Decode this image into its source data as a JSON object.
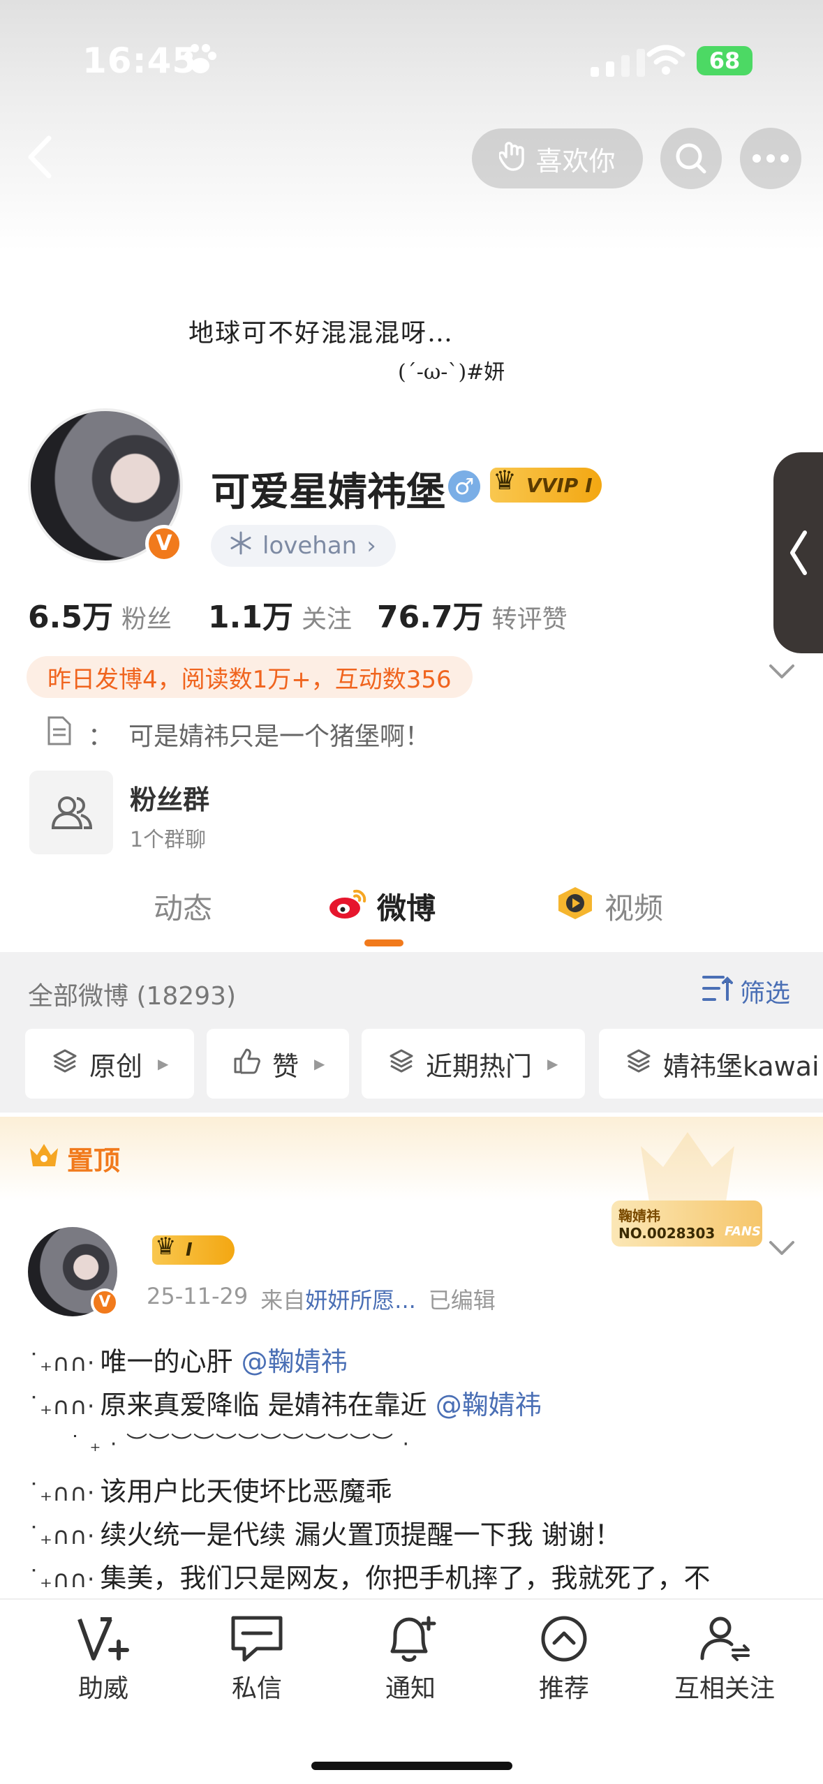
{
  "status_bar": {
    "time": "16:45",
    "battery": "68"
  },
  "nav": {
    "like_label": "喜欢你"
  },
  "header": {
    "signature_line1": "地球可不好混混混呀…",
    "signature_line2": "(´-ω-`)#妍"
  },
  "profile": {
    "username": "可爱星婧祎堡",
    "gender_symbol": "♂",
    "vip_label": "VVIP",
    "vip_level": "I",
    "avatar_badge": "V",
    "tag": "lovehan",
    "tag_arrow": "›",
    "stats": [
      {
        "value": "6.5万",
        "label": "粉丝"
      },
      {
        "value": "1.1万",
        "label": "关注"
      },
      {
        "value": "76.7万",
        "label": "转评赞"
      }
    ],
    "activity": "昨日发博4，阅读数1万+，互动数356",
    "bio_colon": "：",
    "bio": "可是婧祎只是一个猪堡啊！",
    "fans_group_title": "粉丝群",
    "fans_group_sub": "1个群聊"
  },
  "tabs": [
    {
      "label": "动态",
      "active": false
    },
    {
      "label": "微博",
      "active": true
    },
    {
      "label": "视频",
      "active": false
    }
  ],
  "filter": {
    "all_weibo": "全部微博 (18293)",
    "filter_label": "筛选",
    "chips": [
      {
        "label": "原创"
      },
      {
        "label": "赞"
      },
      {
        "label": "近期热门"
      },
      {
        "label": "婧祎堡kawai"
      }
    ]
  },
  "pinned": {
    "label": "置顶",
    "fan_card_name": "鞠婧祎",
    "fan_card_no": "NO.0028303",
    "fan_card_fans": "FANS"
  },
  "post": {
    "badge_level": "I",
    "avatar_badge": "V",
    "date": "25-11-29",
    "source_prefix": "来自",
    "source": "妍妍所愿...",
    "edited": "已编辑",
    "deco": "˙₊∩∩·",
    "lines": [
      {
        "text": "唯一的心肝 ",
        "at": "@鞠婧祎"
      },
      {
        "text": "原来真爱降临 是婧祎在靠近 ",
        "at": "@鞠婧祎"
      },
      {
        "text": "该用户比天使坏比恶魔乖",
        "at": ""
      },
      {
        "text": "续火统一是代续 漏火置顶提醒一下我 谢谢！",
        "at": ""
      },
      {
        "text": "集美，我们只是网友，你把手机摔了，我就死了，不",
        "at": ""
      }
    ],
    "deco_line": "˙  ₊  ·    ︶︶︶︶︶︶︶︶︶︶︶︶      ·"
  },
  "bottom_nav": [
    {
      "label": "助威",
      "icon": "v-plus-icon"
    },
    {
      "label": "私信",
      "icon": "message-icon"
    },
    {
      "label": "通知",
      "icon": "bell-icon"
    },
    {
      "label": "推荐",
      "icon": "up-circle-icon"
    },
    {
      "label": "互相关注",
      "icon": "mutual-follow-icon"
    }
  ],
  "colors": {
    "accent": "#f17a1c",
    "link": "#4a6fb5",
    "vip_gold": "#f3a712"
  }
}
